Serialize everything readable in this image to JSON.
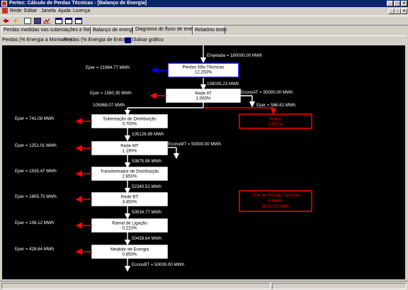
{
  "window": {
    "title": "Pertec: Cálculo de Perdas Técnicas - [Balanço de Energia]"
  },
  "menu": [
    "Rede",
    "Editar",
    "Janela",
    "Ajuda",
    "Licença"
  ],
  "toolbar": {
    "icons": [
      "exit-icon",
      "lightning-icon",
      "calculator-icon",
      "save-icon",
      "chart-icon",
      "window-icon",
      "tile-horizontal-icon",
      "tile-vertical-icon"
    ]
  },
  "tabs": [
    "Perdas medidas nas subestações e Redes AT",
    "Balanço de energia",
    "Diagrama de fluxo de energia",
    "Relatório texto"
  ],
  "active_tab": 2,
  "subtabs": [
    "Perdas (% Energia a Montante)",
    "Perdas (% Energia de Entrada)"
  ],
  "save_chart_label": "Salvar gráfico",
  "diagram": {
    "colors": {
      "flow": "#ffffff",
      "loss": "#ff0000",
      "non_technical": "#0000ff",
      "box_fill": "#ffffff",
      "text": "#000000"
    },
    "injected": "Einjetada = 180000.00 MWh",
    "nodes": [
      {
        "name": "Perdas Não Técnicas",
        "pct": "12.203%",
        "eper": "Eper = 21964.77 MWh",
        "out": "158035.23 MWh"
      },
      {
        "name": "Rede AT",
        "pct": "1.000%",
        "eper": "Eper = 1580.35 MWh",
        "out": "105868.07 MWh",
        "cons": "EconsAT = 50000.00 MWh"
      },
      {
        "name": "Subestação de Distribuição",
        "pct": "0.700%",
        "eper": "Eper = 741.08 MWh",
        "out": "105126.99 MWh"
      },
      {
        "name": "Rede MT",
        "pct": "1.190%",
        "eper": "Eper = 1251.01 MWh",
        "out": "53875.98 MWh",
        "cons": "EconsMT = 50000.00 MWh"
      },
      {
        "name": "Transformador de Distribuição",
        "pct": "2.850%",
        "eper": "Eper = 1535.47 MWh",
        "out": "52340.51 MWh"
      },
      {
        "name": "Rede BT",
        "pct": "3.450%",
        "eper": "Eper = 1805.75 MWh",
        "out": "50534.77 MWh"
      },
      {
        "name": "Ramal de Ligação",
        "pct": "0.210%",
        "eper": "Eper = 106.12 MWh",
        "out": "50428.64 MWh"
      },
      {
        "name": "Medidor de Energia",
        "pct": "0.850%",
        "eper": "Eper = 428.64 MWh",
        "out": "EconsBT = 50000.00 MWh"
      }
    ],
    "others": {
      "name": "Outros",
      "pct": "0.551%",
      "eper": "Eper = 586.81 MWh"
    },
    "total": {
      "title": "Total de Perdas Técnicas",
      "pct": "4.464%",
      "energy": "8035.23 MWh"
    }
  }
}
